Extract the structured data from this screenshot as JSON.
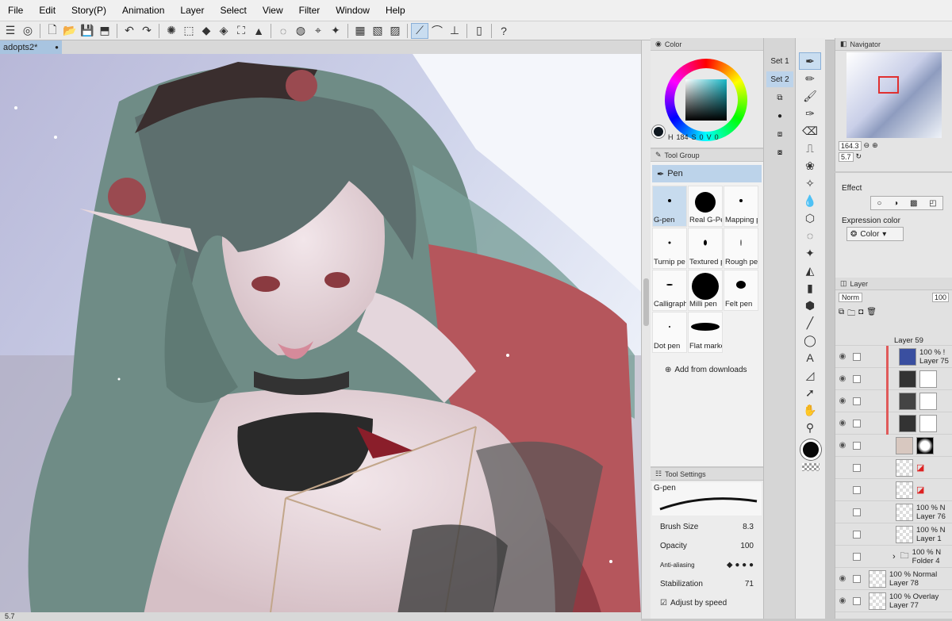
{
  "menu": [
    "File",
    "Edit",
    "Story(P)",
    "Animation",
    "Layer",
    "Select",
    "View",
    "Filter",
    "Window",
    "Help"
  ],
  "doc_tab": {
    "name": "adopts2*",
    "close": "●"
  },
  "color_panel": {
    "tab": "Color",
    "h": "184",
    "s": "0",
    "v": "0",
    "h_label": "H",
    "s_label": "S",
    "v_label": "V"
  },
  "sets": [
    "Set 1",
    "Set 2"
  ],
  "tool_group": {
    "title": "Tool Group",
    "subtool": "Pen",
    "brushes": [
      "G-pen",
      "Real G-Pe",
      "Mapping p",
      "Turnip pe",
      "Textured p",
      "Rough pe",
      "Calligraph",
      "Milli pen",
      "Felt pen",
      "Dot pen",
      "Flat marke"
    ],
    "add": "Add from downloads"
  },
  "tool_settings": {
    "title": "Tool Settings",
    "brush": "G-pen",
    "brush_size_label": "Brush Size",
    "brush_size": "8.3",
    "opacity_label": "Opacity",
    "opacity": "100",
    "aa_label": "Anti-aliasing",
    "stab_label": "Stabilization",
    "stab": "71",
    "adjust": "Adjust by speed"
  },
  "navigator": {
    "title": "Navigator",
    "zoom": "164.3",
    "rot": "5.7"
  },
  "effect": {
    "label": "Effect",
    "expr_label": "Expression color",
    "expr_value": "Color"
  },
  "layers": {
    "title": "Layer",
    "blend": "Norm",
    "opacity": "100",
    "rows": [
      {
        "l1": "Layer 59",
        "l2": ""
      },
      {
        "l1": "100 % !",
        "l2": "Layer 75"
      },
      {
        "l1": "",
        "l2": ""
      },
      {
        "l1": "",
        "l2": ""
      },
      {
        "l1": "",
        "l2": ""
      },
      {
        "l1": "",
        "l2": ""
      },
      {
        "l1": "",
        "l2": ""
      },
      {
        "l1": "",
        "l2": ""
      },
      {
        "l1": "100 % N",
        "l2": "Layer 76"
      },
      {
        "l1": "100 % N",
        "l2": "Layer 1"
      },
      {
        "l1": "100 % N",
        "l2": "Folder 4"
      },
      {
        "l1": "100 % Normal",
        "l2": "Layer 78"
      },
      {
        "l1": "100 % Overlay",
        "l2": "Layer 77"
      }
    ]
  },
  "status": {
    "zoom": "5.7"
  },
  "colors": {
    "accent": "#c9ddf0",
    "selected": "#bcd3ea",
    "mark": "#e05a5a"
  }
}
